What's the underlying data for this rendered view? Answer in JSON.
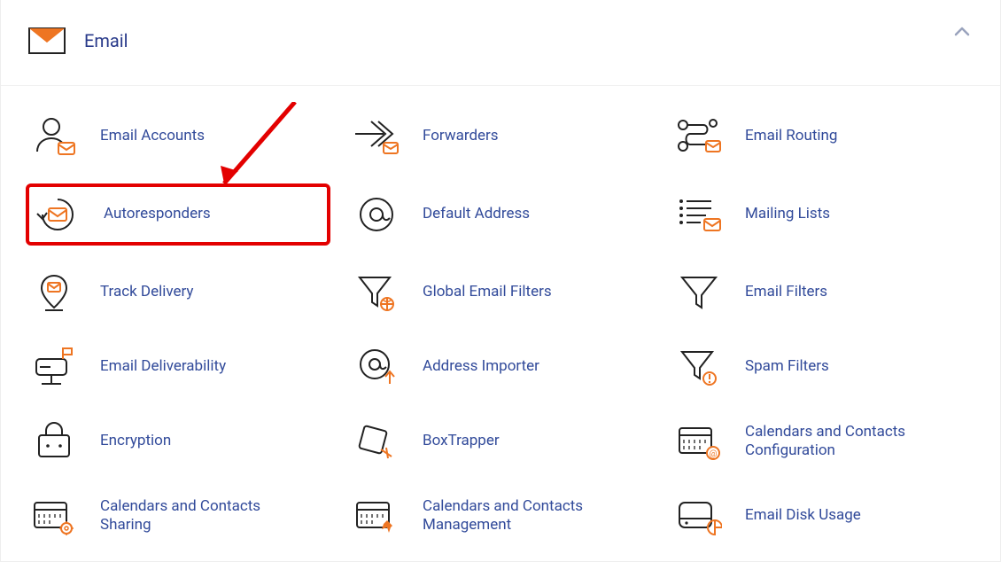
{
  "panel": {
    "title": "Email"
  },
  "items": [
    {
      "label": "Email Accounts"
    },
    {
      "label": "Forwarders"
    },
    {
      "label": "Email Routing"
    },
    {
      "label": "Autoresponders"
    },
    {
      "label": "Default Address"
    },
    {
      "label": "Mailing Lists"
    },
    {
      "label": "Track Delivery"
    },
    {
      "label": "Global Email Filters"
    },
    {
      "label": "Email Filters"
    },
    {
      "label": "Email Deliverability"
    },
    {
      "label": "Address Importer"
    },
    {
      "label": "Spam Filters"
    },
    {
      "label": "Encryption"
    },
    {
      "label": "BoxTrapper"
    },
    {
      "label": "Calendars and Contacts Configuration"
    },
    {
      "label": "Calendars and Contacts Sharing"
    },
    {
      "label": "Calendars and Contacts Management"
    },
    {
      "label": "Email Disk Usage"
    }
  ]
}
